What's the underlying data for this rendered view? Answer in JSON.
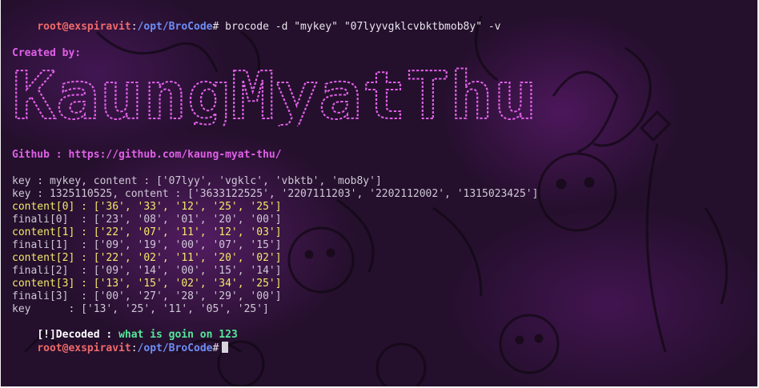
{
  "prompt": {
    "user": "root@exspiravit",
    "sep": ":",
    "path": "/opt/BroCode",
    "symbol": "#"
  },
  "command": " brocode -d \"mykey\" \"07lyyvgklcvbktbmob8y\" -v",
  "created_by_label": "Created by:",
  "banner_text": "KaungMyatThu",
  "github_line": "Github : https://github.com/kaung-myat-thu/",
  "key_line_1": "key : mykey, content : ['07lyy', 'vgklc', 'vbktb', 'mob8y']",
  "key_line_2": "key : 1325110525, content : ['3633122525', '2207111203', '2202112002', '1315023425']",
  "content_0": "content[0] : ['36', '33', '12', '25', '25']",
  "finali_0": "finali[0]  : ['23', '08', '01', '20', '00']",
  "content_1": "content[1] : ['22', '07', '11', '12', '03']",
  "finali_1": "finali[1]  : ['09', '19', '00', '07', '15']",
  "content_2": "content[2] : ['22', '02', '11', '20', '02']",
  "finali_2": "finali[2]  : ['09', '14', '00', '15', '14']",
  "content_3": "content[3] : ['13', '15', '02', '34', '25']",
  "finali_3": "finali[3]  : ['00', '27', '28', '29', '00']",
  "key_final": "key      : ['13', '25', '11', '05', '25']",
  "decoded_label": "[!]Decoded : ",
  "decoded_value": "what is goin on 123",
  "colors": {
    "background": "#240f2c",
    "user": "#f06a6a",
    "path": "#6d8ef5",
    "banner": "#e060e8",
    "content": "#f4e86a",
    "decoded": "#55e89a"
  }
}
